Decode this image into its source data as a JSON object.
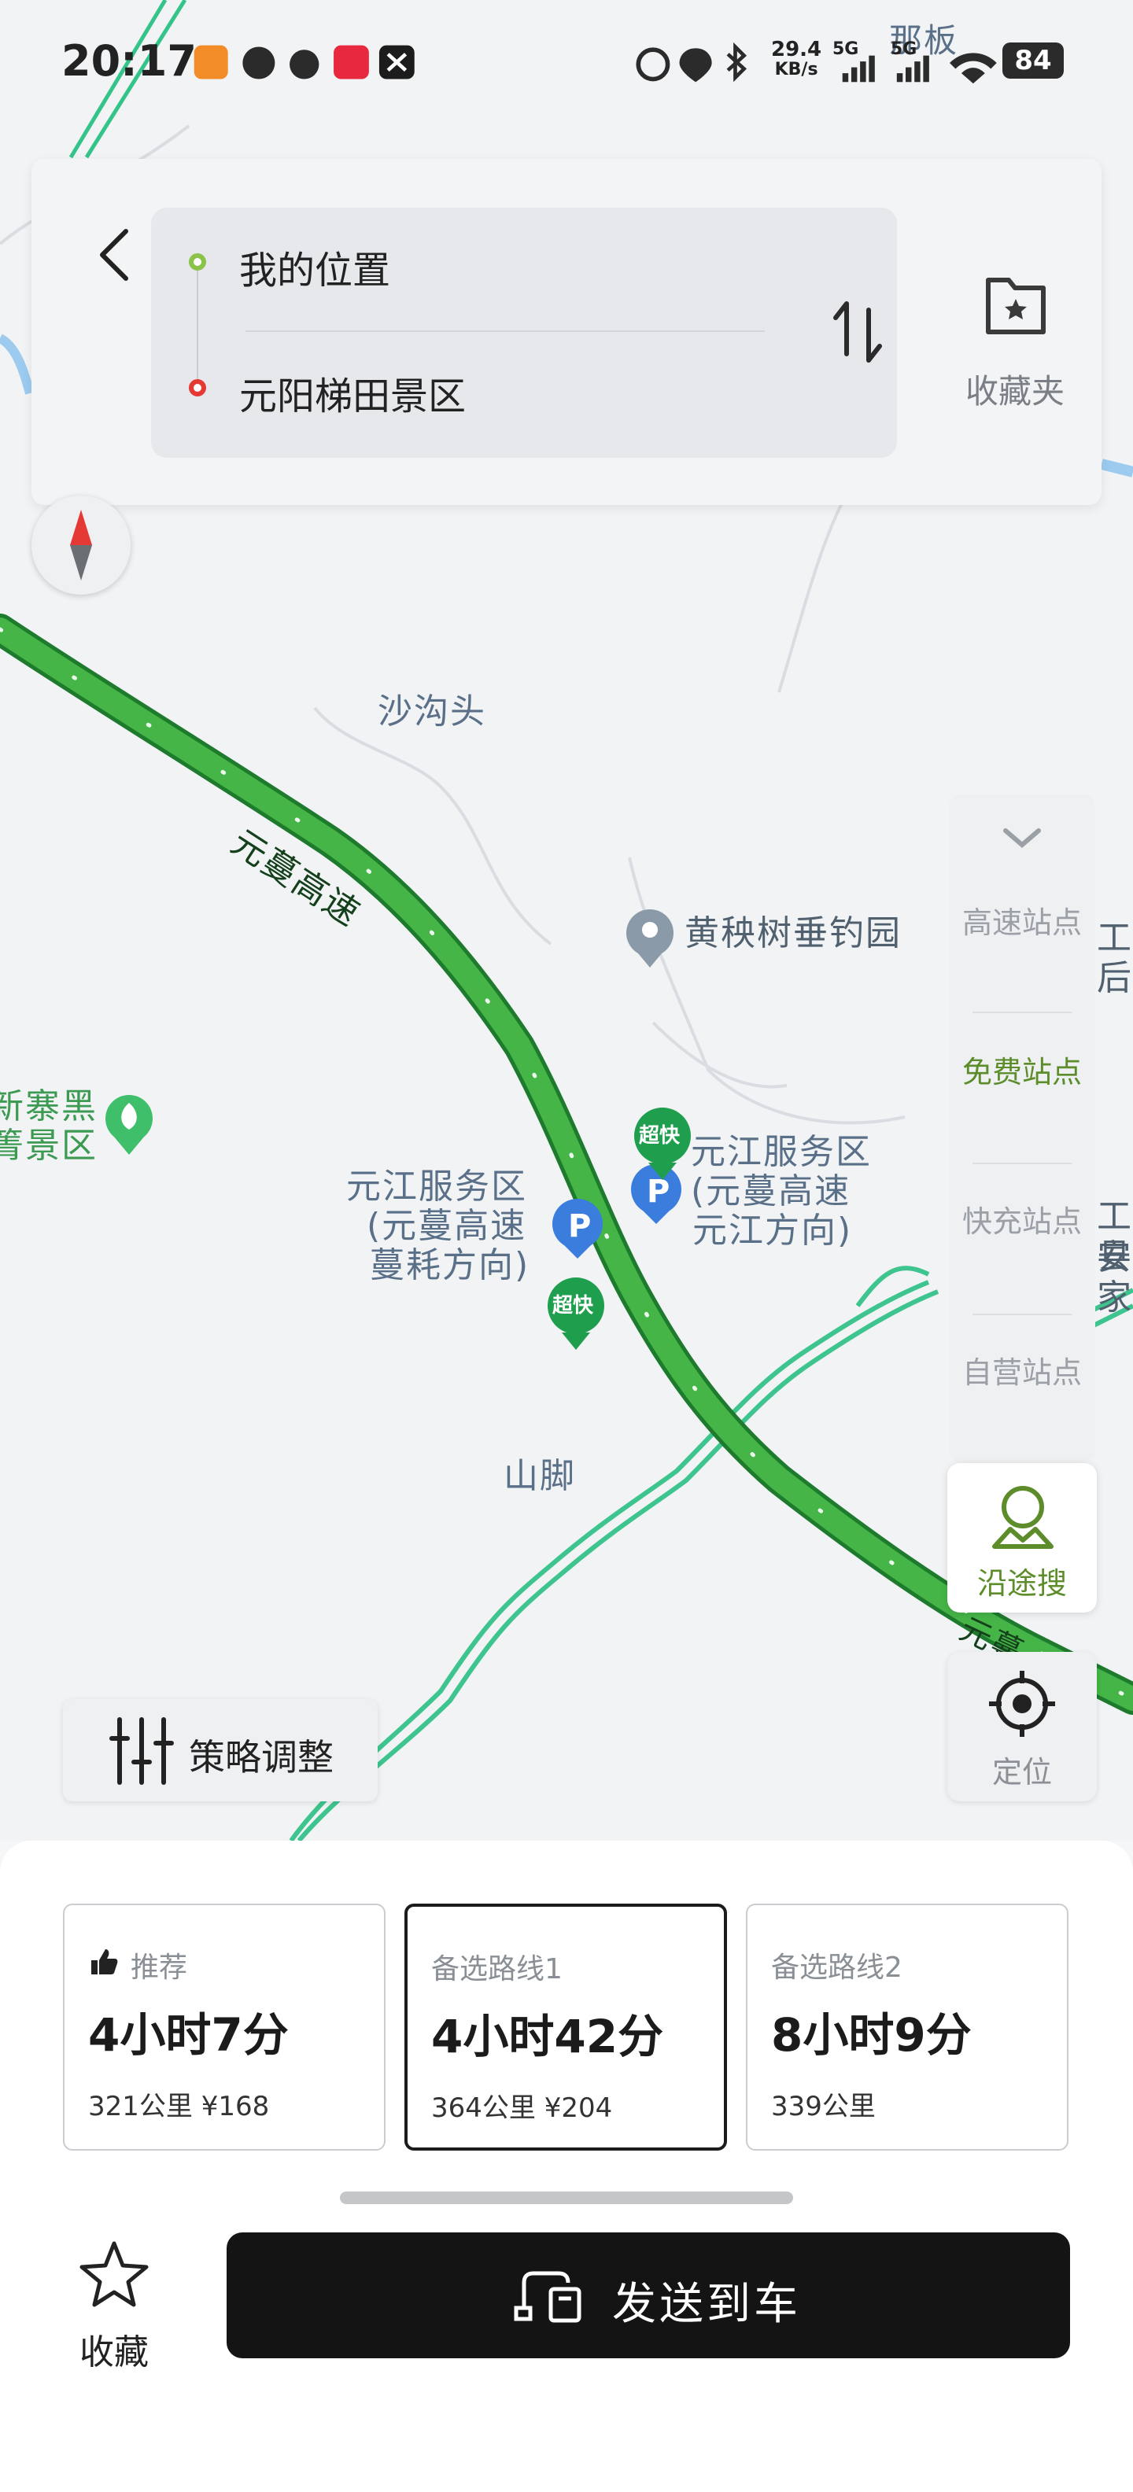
{
  "status_bar": {
    "time": "20:17",
    "network_speed_value": "29.4",
    "network_speed_unit": "KB/s",
    "signal1": "5G",
    "signal2": "5G",
    "battery": "84",
    "left_icons": [
      "app-icon-1",
      "app-icon-2",
      "weibo-icon",
      "xiaohongshu-icon",
      "app-icon-x"
    ],
    "right_icons": [
      "alarm-icon",
      "location-icon",
      "bluetooth-icon",
      "wifi-icon",
      "battery-icon"
    ]
  },
  "route": {
    "origin": "我的位置",
    "destination": "元阳梯田景区",
    "origin_color": "#8bc34a",
    "destination_color": "#e53935"
  },
  "favorites_folder_label": "收藏夹",
  "map": {
    "road_name": "元蔓高速",
    "road_name_2": "元蔓",
    "labels": {
      "place1": "沙沟头",
      "place2": "黄秧树垂钓园",
      "place3": "山脚",
      "scenic_line1": "新寨黑",
      "scenic_line2": "箐景区",
      "service_left_line1": "元江服务区",
      "service_left_line2": "(元蔓高速",
      "service_left_line3": "蔓耗方向)",
      "service_right_line1": "元江服务区",
      "service_right_line2": "(元蔓高速",
      "service_right_line3": "元江方向)",
      "edge_right1": "工后",
      "edge_right2": "工县",
      "edge_right3": "安家",
      "top_edge": "那板",
      "badge": "超快"
    },
    "route_color": "#3aa63a"
  },
  "side_panel": {
    "items": [
      "高速站点",
      "免费站点",
      "快充站点",
      "自营站点"
    ],
    "active_index": 1,
    "along_search": "沿途搜",
    "locate": "定位"
  },
  "strategy_button": "策略调整",
  "route_options": [
    {
      "tag": "推荐",
      "duration": "4小时7分",
      "meta": "321公里 ¥168",
      "selected": false
    },
    {
      "tag": "备选路线1",
      "duration": "4小时42分",
      "meta": "364公里 ¥204",
      "selected": true
    },
    {
      "tag": "备选路线2",
      "duration": "8小时9分",
      "meta": "339公里",
      "selected": false
    }
  ],
  "favorite_button": "收藏",
  "send_to_car_button": "发送到车"
}
